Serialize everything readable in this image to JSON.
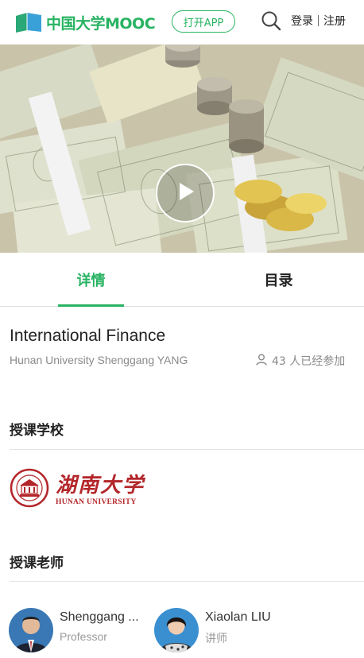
{
  "header": {
    "logo_text": "中国大学MOOC",
    "open_app_label": "打开APP",
    "login_label": "登录",
    "register_label": "注册"
  },
  "tabs": [
    {
      "label": "详情",
      "active": true
    },
    {
      "label": "目录",
      "active": false
    }
  ],
  "course": {
    "title": "International Finance",
    "subtitle": "Hunan University Shenggang YANG",
    "enrolled_text": "43 人已经参加"
  },
  "school_section": {
    "title": "授课学校",
    "school_name_cn": "湖南大学",
    "school_name_en": "HUNAN UNIVERSITY"
  },
  "teacher_section": {
    "title": "授课老师",
    "teachers": [
      {
        "name": "Shenggang ...",
        "role": "Professor"
      },
      {
        "name": "Xiaolan LIU",
        "role": "讲师"
      }
    ]
  },
  "colors": {
    "brand_green": "#28b362",
    "school_red": "#b3262a"
  },
  "icons": [
    "mooc-logo-icon",
    "search-icon",
    "play-icon",
    "person-icon",
    "hunan-university-emblem-icon"
  ]
}
